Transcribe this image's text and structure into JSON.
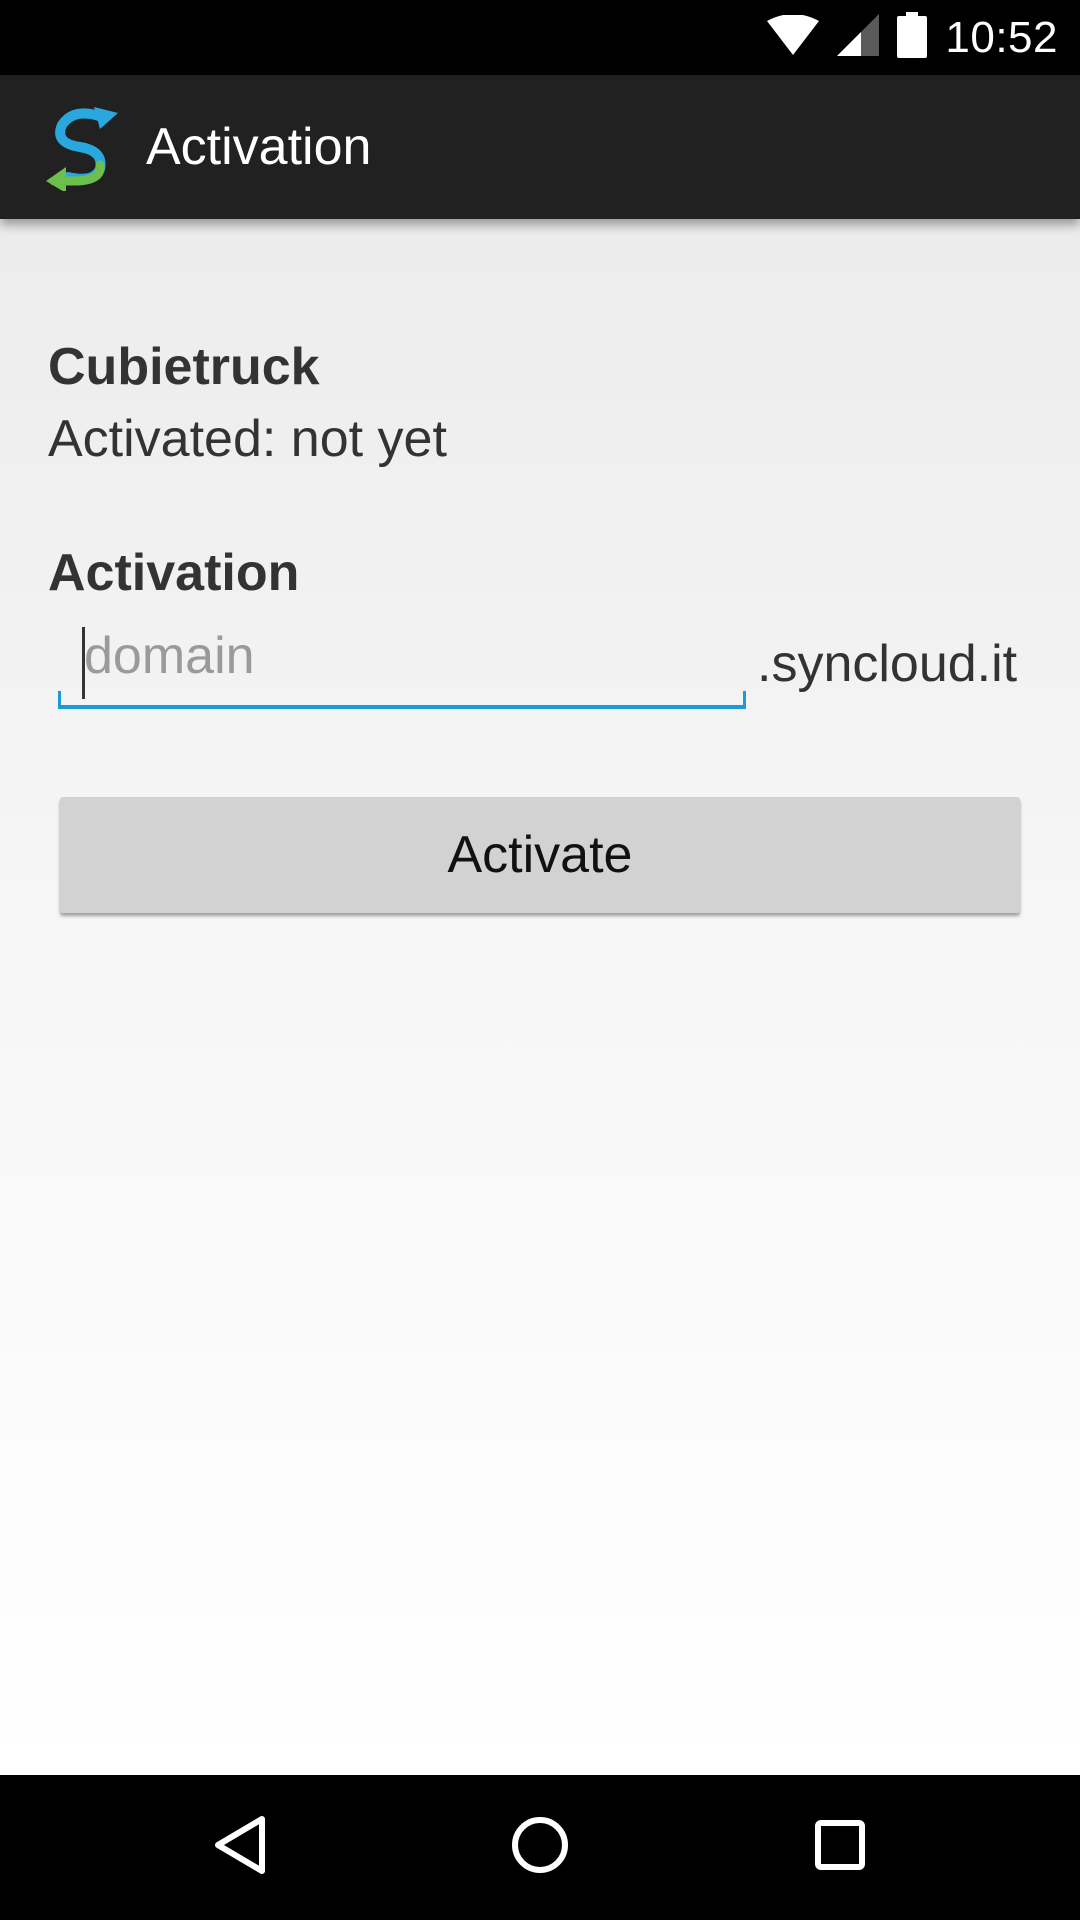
{
  "status_bar": {
    "time": "10:52",
    "icons": [
      "wifi-icon",
      "cell-signal-icon",
      "battery-icon"
    ]
  },
  "app_bar": {
    "logo": "syncloud-logo",
    "title": "Activation"
  },
  "device": {
    "name": "Cubietruck",
    "status": "Activated: not yet"
  },
  "activation": {
    "section_title": "Activation",
    "domain_value": "",
    "domain_placeholder": "domain",
    "domain_suffix": ".syncloud.it",
    "button_label": "Activate"
  },
  "nav_bar": {
    "buttons": [
      "back-icon",
      "home-icon",
      "recents-icon"
    ]
  },
  "colors": {
    "accent": "#1a9bd7",
    "app_bar": "#212121",
    "button": "#d2d2d2",
    "logo_blue": "#29a8e0",
    "logo_green": "#6dbf4b"
  }
}
